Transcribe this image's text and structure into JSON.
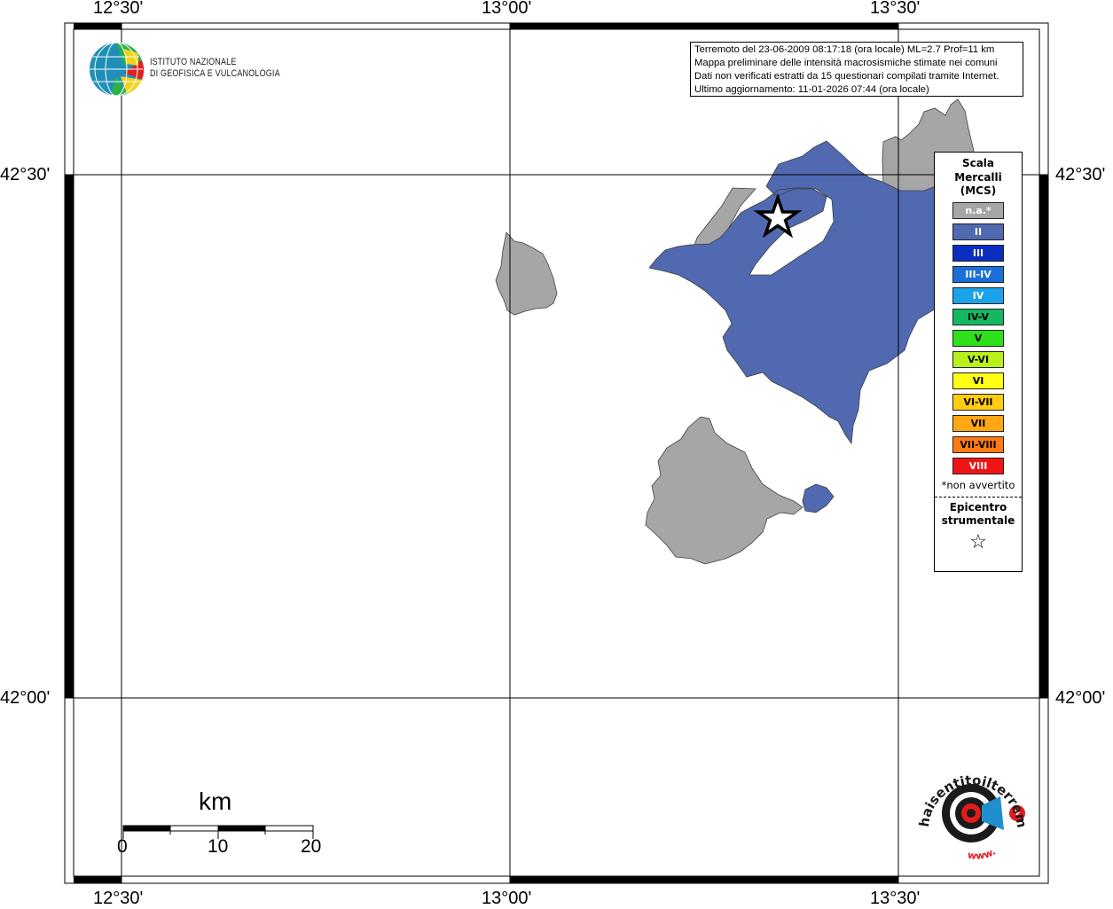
{
  "map": {
    "lon_ticks": [
      "12°30'",
      "13°00'",
      "13°30'"
    ],
    "lat_ticks": [
      "42°30'",
      "42°00'"
    ]
  },
  "info": {
    "line1": "Terremoto del 23-06-2009 08:17:18 (ora locale) ML=2.7 Prof=11 km",
    "line2": "Mappa preliminare delle intensità macrosismiche stimate nei comuni",
    "line3": "Dati non verificati estratti da 15 questionari compilati tramite Internet.",
    "line4": "Ultimo aggiornamento: 11-01-2026 07:44 (ora locale)"
  },
  "ingv_logo": {
    "line1": "ISTITUTO NAZIONALE",
    "line2": "DI GEOFISICA E VULCANOLOGIA"
  },
  "legend": {
    "title_line1": "Scala",
    "title_line2": "Mercalli",
    "title_line3": "(MCS)",
    "items": [
      {
        "label": "n.a.*",
        "color": "#a6a6a6",
        "text_color": "#ffffff"
      },
      {
        "label": "II",
        "color": "#5069b0",
        "text_color": "#ffffff"
      },
      {
        "label": "III",
        "color": "#0a2ec0",
        "text_color": "#ffffff"
      },
      {
        "label": "III-IV",
        "color": "#1a6fd9",
        "text_color": "#ffffff"
      },
      {
        "label": "IV",
        "color": "#1aa3e8",
        "text_color": "#ffffff"
      },
      {
        "label": "IV-V",
        "color": "#14b860",
        "text_color": "#000000"
      },
      {
        "label": "V",
        "color": "#2ee01a",
        "text_color": "#000000"
      },
      {
        "label": "V-VI",
        "color": "#b8f01a",
        "text_color": "#000000"
      },
      {
        "label": "VI",
        "color": "#ffff14",
        "text_color": "#000000"
      },
      {
        "label": "VI-VII",
        "color": "#ffcc14",
        "text_color": "#000000"
      },
      {
        "label": "VII",
        "color": "#ffa814",
        "text_color": "#000000"
      },
      {
        "label": "VII-VIII",
        "color": "#ff7a14",
        "text_color": "#000000"
      },
      {
        "label": "VIII",
        "color": "#f01414",
        "text_color": "#ffffff"
      }
    ],
    "note": "*non avvertito",
    "epicenter_line1": "Epicentro",
    "epicenter_line2": "strumentale"
  },
  "scale_bar": {
    "unit": "km",
    "labels": [
      "0",
      "10",
      "20"
    ]
  },
  "hsit_logo": {
    "arc_text": "haisentitoilterremoto.it",
    "url_text": "www."
  }
}
